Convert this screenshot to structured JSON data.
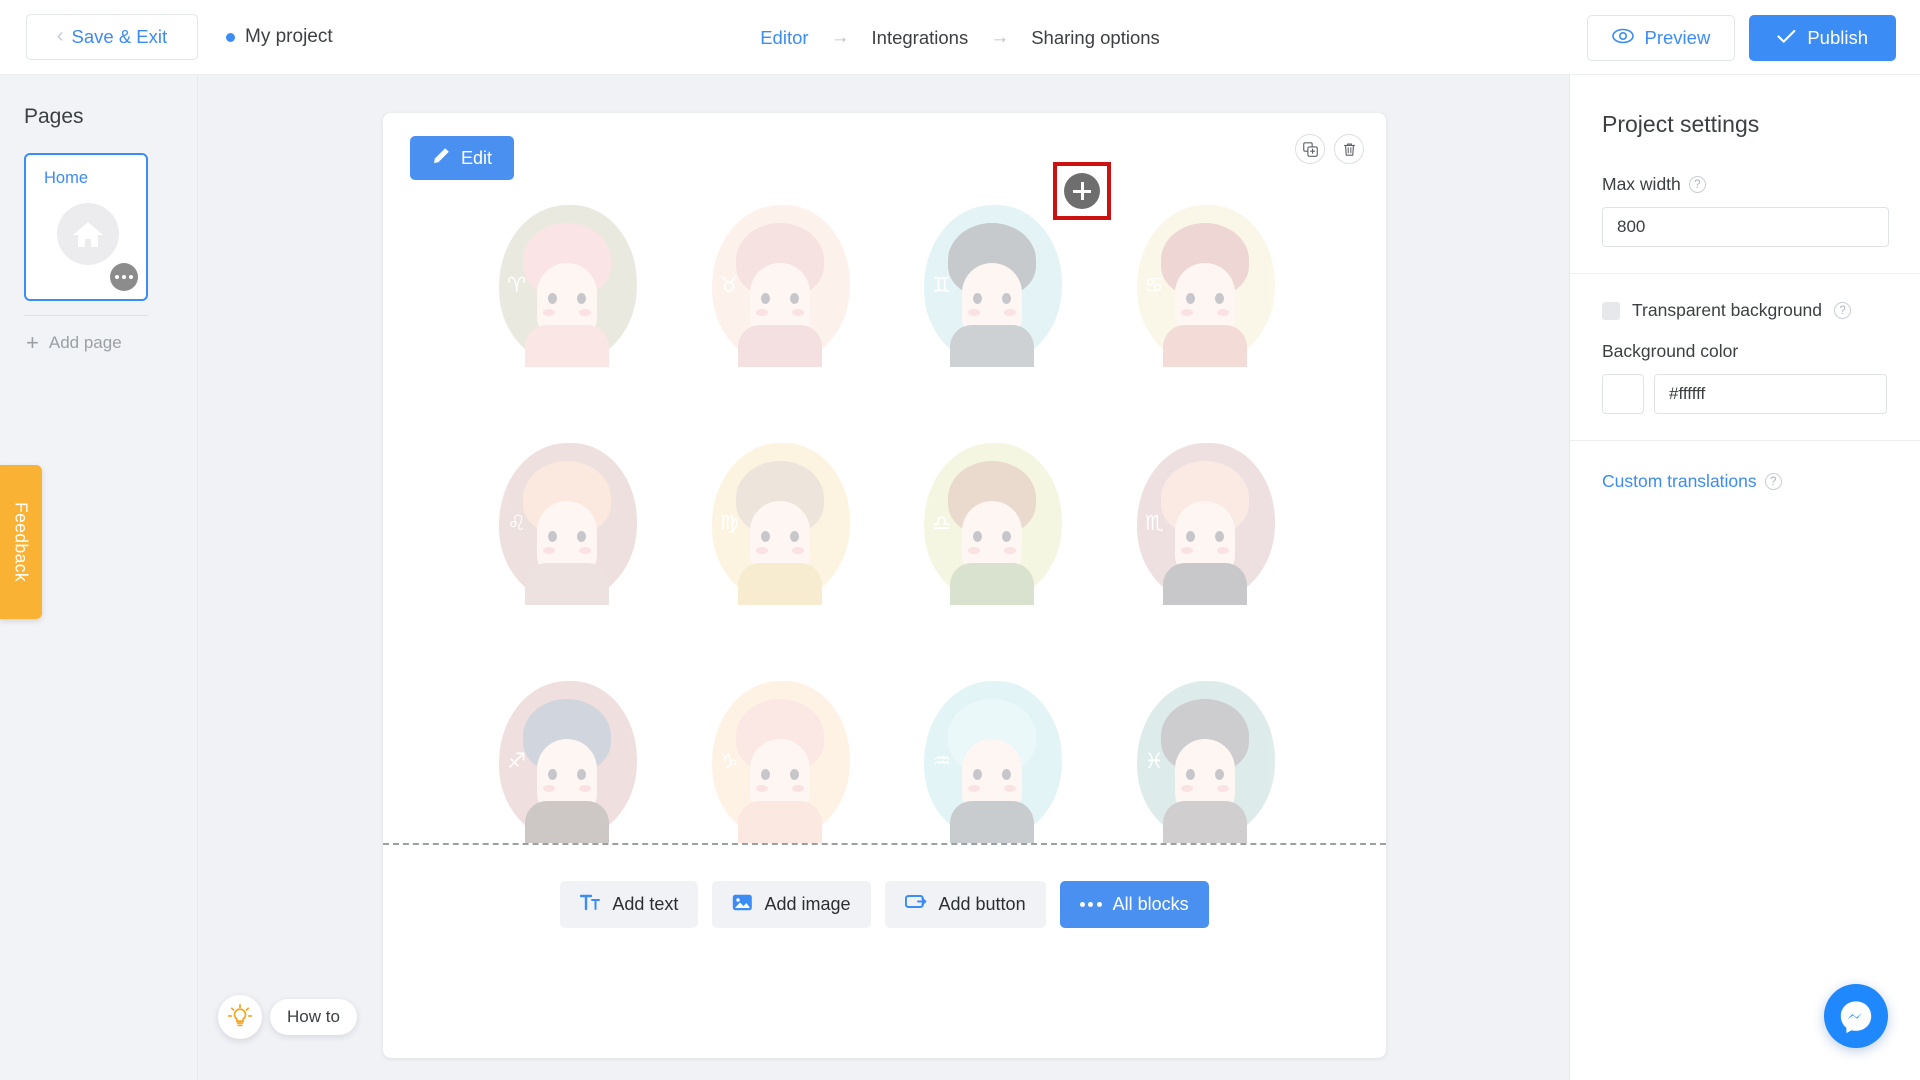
{
  "topbar": {
    "save_exit": "Save & Exit",
    "project_name": "My project",
    "breadcrumbs": [
      {
        "label": "Editor",
        "active": true
      },
      {
        "label": "Integrations",
        "active": false
      },
      {
        "label": "Sharing options",
        "active": false
      }
    ],
    "arrow": "→",
    "preview": "Preview",
    "publish": "Publish",
    "accent_color": "#3b8cf5"
  },
  "sidebar": {
    "title": "Pages",
    "pages": [
      {
        "name": "Home",
        "selected": true
      }
    ],
    "add_page": "Add page",
    "feedback_tab": "Feedback",
    "feedback_color": "#f9b233"
  },
  "canvas": {
    "edit_button": "Edit",
    "add_block_button_highlighted": true,
    "highlight_color": "#cc1111",
    "tools": [
      {
        "name": "duplicate-block"
      },
      {
        "name": "delete-block"
      }
    ],
    "zodiac": [
      {
        "sign": "Aries",
        "symbol": "♈",
        "blob": "#b9b897",
        "hair": "#f0a9ae",
        "skin": "#fbe2d6",
        "body": "#f3b0ae"
      },
      {
        "sign": "Taurus",
        "symbol": "♉",
        "blob": "#f8d6c0",
        "hair": "#e8a0a3",
        "skin": "#fbe2d6",
        "body": "#de9b9c"
      },
      {
        "sign": "Gemini",
        "symbol": "♊",
        "blob": "#a8dde2",
        "hair": "#44545c",
        "skin": "#fbe2d6",
        "body": "#5b6a70"
      },
      {
        "sign": "Cancer",
        "symbol": "♋",
        "blob": "#f3e8b6",
        "hair": "#c77a6f",
        "skin": "#fbe2d6",
        "body": "#d98a7f"
      },
      {
        "sign": "Leo",
        "symbol": "♌",
        "blob": "#c79a94",
        "hair": "#f2b996",
        "skin": "#fbe2d6",
        "body": "#c9a09a"
      },
      {
        "sign": "Virgo",
        "symbol": "♍",
        "blob": "#f7de9f",
        "hair": "#c7a98c",
        "skin": "#fbe2d6",
        "body": "#e5c267"
      },
      {
        "sign": "Libra",
        "symbol": "♎",
        "blob": "#e0e2a2",
        "hair": "#b8865e",
        "skin": "#fbe2d6",
        "body": "#7fa060"
      },
      {
        "sign": "Scorpio",
        "symbol": "♏",
        "blob": "#c8969c",
        "hair": "#f2bba6",
        "skin": "#fbe2d6",
        "body": "#4c4c53"
      },
      {
        "sign": "Sagittarius",
        "symbol": "♐",
        "blob": "#cb9a96",
        "hair": "#6a7690",
        "skin": "#fbe2d6",
        "body": "#5b4a47"
      },
      {
        "sign": "Capricorn",
        "symbol": "♑",
        "blob": "#fad5a8",
        "hair": "#f4b3a6",
        "skin": "#fbe2d6",
        "body": "#f0b49d"
      },
      {
        "sign": "Aquarius",
        "symbol": "♒",
        "blob": "#a6dee2",
        "hair": "#bfe9ee",
        "skin": "#fbe2d6",
        "body": "#4f5a60"
      },
      {
        "sign": "Pisces",
        "symbol": "♓",
        "blob": "#92c2bd",
        "hair": "#5b5963",
        "skin": "#fbe2d6",
        "body": "#6a5f62"
      }
    ],
    "block_buttons": [
      {
        "label": "Add text",
        "icon": "text-icon",
        "primary": false
      },
      {
        "label": "Add image",
        "icon": "image-icon",
        "primary": false
      },
      {
        "label": "Add button",
        "icon": "button-icon",
        "primary": false
      },
      {
        "label": "All blocks",
        "icon": "dots-icon",
        "primary": true
      }
    ],
    "how_to": "How to"
  },
  "settings": {
    "title": "Project settings",
    "max_width_label": "Max width",
    "max_width_value": "800",
    "transparent_background_label": "Transparent background",
    "transparent_background_checked": false,
    "background_color_label": "Background color",
    "background_color_value": "#ffffff",
    "custom_translations": "Custom translations",
    "help_glyph": "?"
  }
}
